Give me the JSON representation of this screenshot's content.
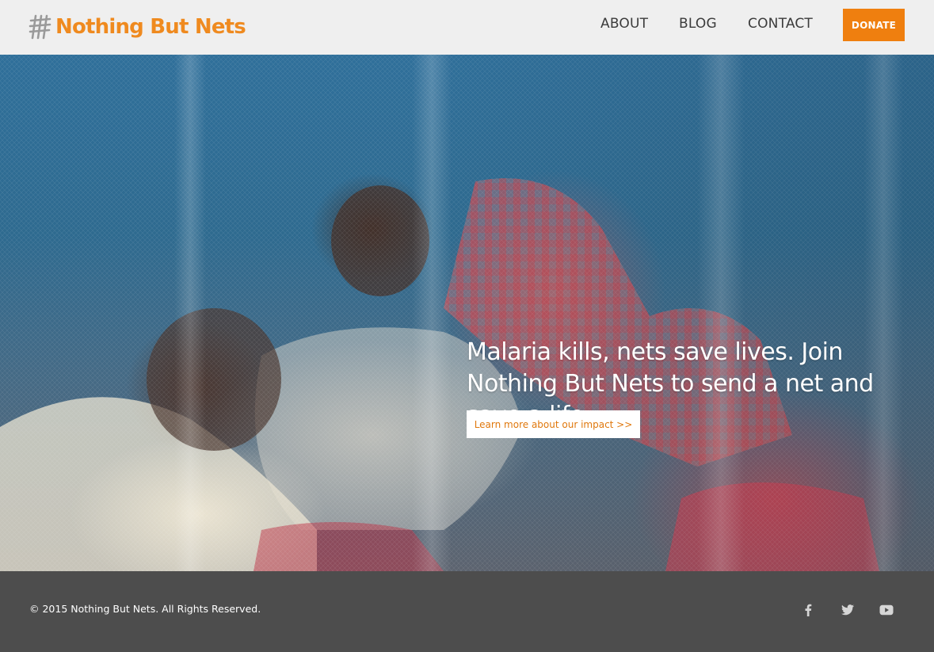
{
  "brand": {
    "name": "Nothing But Nets",
    "logo_icon": "net-logo-icon",
    "accent_color": "#ef8a1f"
  },
  "nav": {
    "items": [
      {
        "label": "ABOUT"
      },
      {
        "label": "BLOG"
      },
      {
        "label": "CONTACT"
      }
    ],
    "donate_label": "DONATE"
  },
  "hero": {
    "headline": "Malaria kills, nets save lives. Join Nothing But Nets to send a net and save a life.",
    "cta_label": "Learn more about our impact >>"
  },
  "footer": {
    "copyright": "© 2015 Nothing But Nets. All Rights Reserved.",
    "social": [
      {
        "icon": "facebook-icon"
      },
      {
        "icon": "twitter-icon"
      },
      {
        "icon": "youtube-icon"
      }
    ]
  },
  "colors": {
    "header_bg": "#efefef",
    "donate_bg": "#ef7f0f",
    "footer_bg": "#4d4d4d",
    "cta_text": "#e0780d"
  }
}
